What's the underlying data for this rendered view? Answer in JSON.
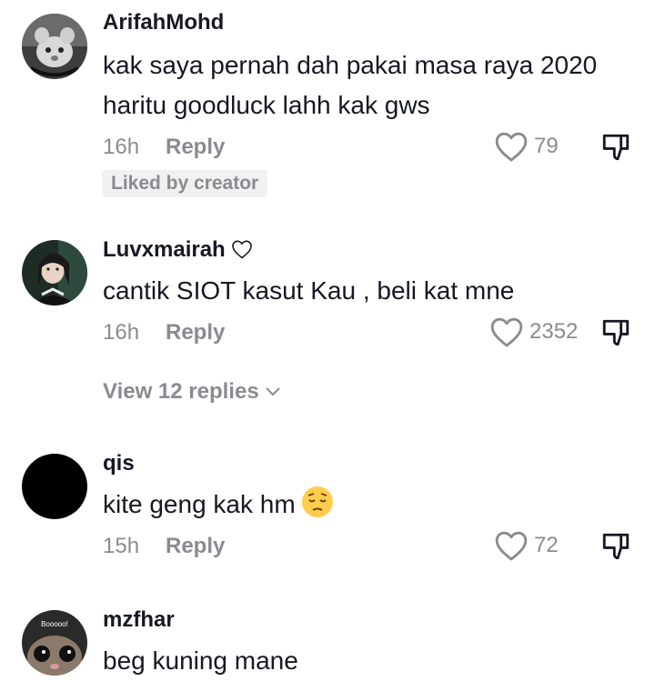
{
  "comments": [
    {
      "username": "ArifahMohd",
      "text": "kak saya pernah dah pakai masa raya 2020 haritu goodluck lahh kak gws",
      "time": "16h",
      "reply": "Reply",
      "likes": "79",
      "badge": "Liked by creator"
    },
    {
      "username": "Luvxmairah",
      "text": "cantik SIOT kasut Kau , beli kat mne",
      "time": "16h",
      "reply": "Reply",
      "likes": "2352",
      "view_replies": "View 12 replies"
    },
    {
      "username": "qis",
      "text": "kite geng kak hm",
      "time": "15h",
      "reply": "Reply",
      "likes": "72",
      "emoji": "pensive-face"
    },
    {
      "username": "mzfhar",
      "text": "beg kuning mane",
      "avatar_text": "Booooo!"
    }
  ],
  "colors": {
    "primary_text": "#161823",
    "secondary_text": "#8a8b91",
    "badge_bg": "#f1f1f2"
  },
  "icons": {
    "like": "heart-outline-icon",
    "dislike": "thumbs-down-icon",
    "chevron": "chevron-down-icon"
  }
}
